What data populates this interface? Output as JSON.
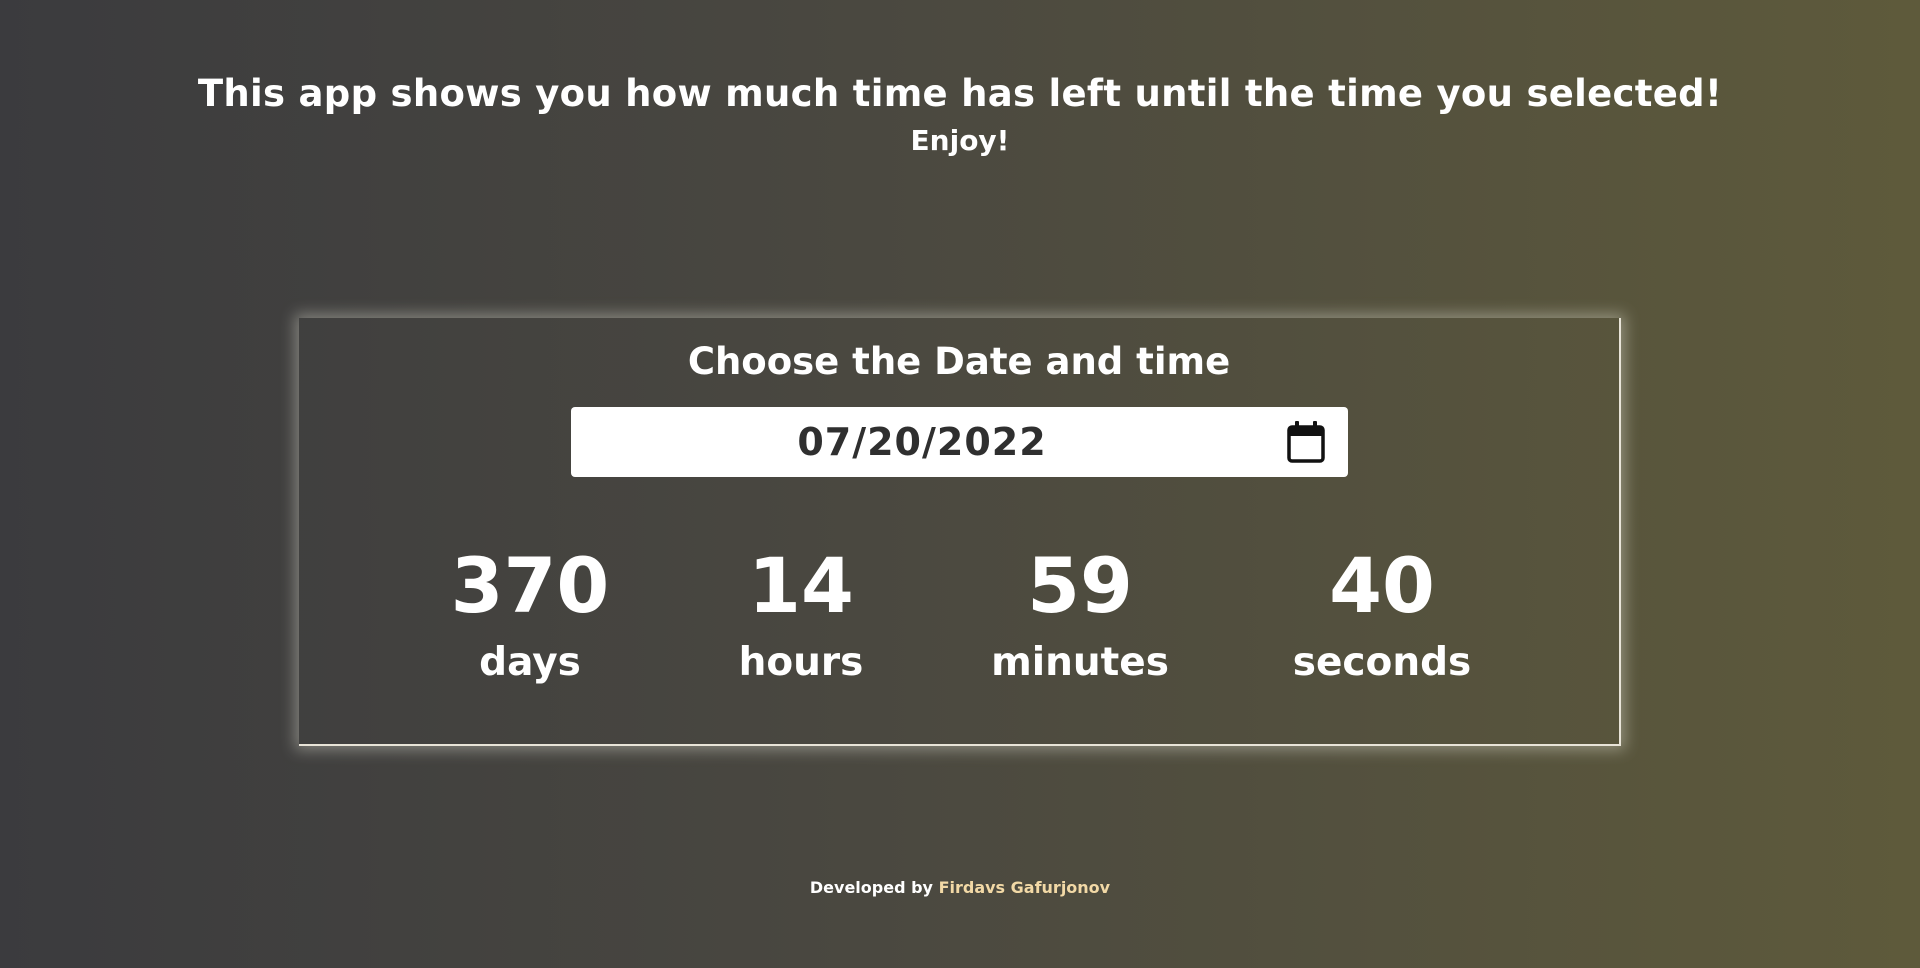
{
  "header": {
    "headline": "This app shows you how much time has left until the time you selected!",
    "subline": "Enjoy!"
  },
  "card": {
    "title": "Choose the Date and time",
    "date_value": "07/20/2022",
    "calendar_icon": "calendar-icon"
  },
  "countdown": {
    "days": {
      "value": "370",
      "unit": "days"
    },
    "hours": {
      "value": "14",
      "unit": "hours"
    },
    "minutes": {
      "value": "59",
      "unit": "minutes"
    },
    "seconds": {
      "value": "40",
      "unit": "seconds"
    }
  },
  "footer": {
    "prefix": "Developed by",
    "author": "Firdavs Gafurjonov"
  },
  "colors": {
    "background_start": "#3b3b3e",
    "background_end": "#5e5a3b",
    "author_link": "#f2d9a6"
  }
}
